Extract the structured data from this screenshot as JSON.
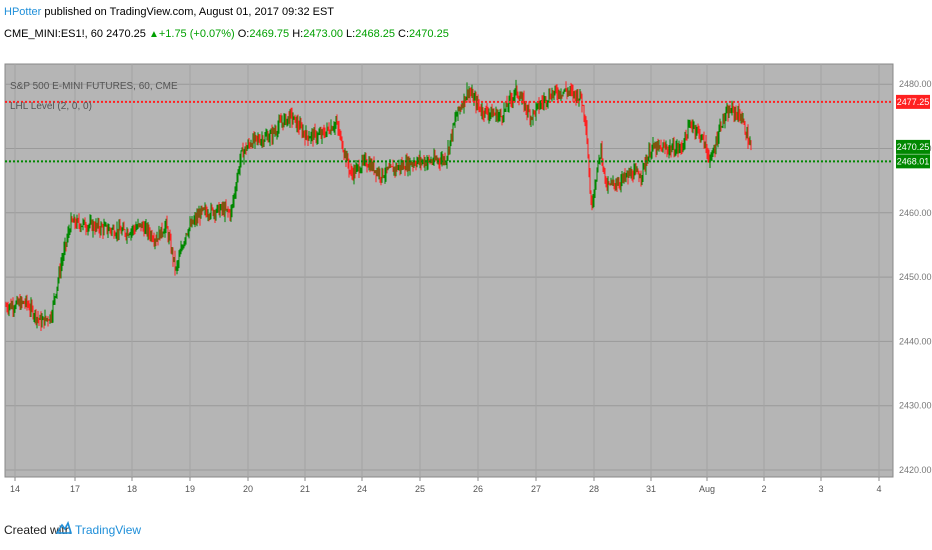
{
  "header": {
    "author": "HPotter",
    "published_text": "published on TradingView.com, August 01, 2017 09:32 EST",
    "symbol_line": "CME_MINI:ES1!, 60",
    "last_price": "2470.25",
    "change_arrow": "▲",
    "change": "+1.75 (+0.07%)",
    "o_label": "O:",
    "o_value": "2469.75",
    "h_label": "H:",
    "h_value": "2473.00",
    "l_label": "L:",
    "l_value": "2468.25",
    "c_label": "C:",
    "c_value": "2470.25"
  },
  "chart_data": {
    "type": "candlestick",
    "title": "S&P 500 E-MINI FUTURES, 60, CME",
    "indicator_label": "LHL Level (2, 0, 0)",
    "y_ticks": [
      2420,
      2430,
      2440,
      2450,
      2460,
      2470,
      2480
    ],
    "y_tick_labels": [
      "2420.00",
      "2430.00",
      "2440.00",
      "2450.00",
      "2460.00",
      "2470.00",
      "2480.00"
    ],
    "ylim": [
      2419.5,
      2483
    ],
    "x_tick_labels": [
      "14",
      "17",
      "18",
      "19",
      "20",
      "21",
      "24",
      "25",
      "26",
      "27",
      "28",
      "31",
      "Aug",
      "2",
      "3",
      "4"
    ],
    "anchors": [
      [
        0,
        2445.5
      ],
      [
        20,
        2446
      ],
      [
        35,
        2443
      ],
      [
        45,
        2444
      ],
      [
        55,
        2452
      ],
      [
        65,
        2458.5
      ],
      [
        85,
        2458
      ],
      [
        100,
        2457.5
      ],
      [
        120,
        2457
      ],
      [
        135,
        2458
      ],
      [
        150,
        2456
      ],
      [
        160,
        2458
      ],
      [
        170,
        2451
      ],
      [
        180,
        2457
      ],
      [
        195,
        2460
      ],
      [
        215,
        2460.5
      ],
      [
        225,
        2460
      ],
      [
        235,
        2469
      ],
      [
        245,
        2471
      ],
      [
        265,
        2472
      ],
      [
        275,
        2474
      ],
      [
        285,
        2475
      ],
      [
        300,
        2472
      ],
      [
        315,
        2472
      ],
      [
        330,
        2474
      ],
      [
        345,
        2466
      ],
      [
        360,
        2468
      ],
      [
        375,
        2466
      ],
      [
        390,
        2467
      ],
      [
        410,
        2468
      ],
      [
        425,
        2468
      ],
      [
        440,
        2468.5
      ],
      [
        450,
        2475
      ],
      [
        462,
        2479
      ],
      [
        475,
        2476
      ],
      [
        495,
        2475
      ],
      [
        510,
        2479
      ],
      [
        525,
        2475
      ],
      [
        535,
        2477
      ],
      [
        545,
        2478.5
      ],
      [
        560,
        2479
      ],
      [
        575,
        2478
      ],
      [
        580,
        2474
      ],
      [
        585,
        2461
      ],
      [
        595,
        2470
      ],
      [
        600,
        2464
      ],
      [
        615,
        2465
      ],
      [
        625,
        2466
      ],
      [
        635,
        2466
      ],
      [
        645,
        2470
      ],
      [
        660,
        2470
      ],
      [
        675,
        2470
      ],
      [
        685,
        2474
      ],
      [
        695,
        2472
      ],
      [
        705,
        2468
      ],
      [
        715,
        2474
      ],
      [
        725,
        2476
      ],
      [
        735,
        2475
      ],
      [
        745,
        2470
      ]
    ],
    "levels": [
      {
        "name": "resistance",
        "value": 2477.25,
        "label": "2477.25",
        "color": "#ff2020"
      },
      {
        "name": "support",
        "value": 2468.0,
        "label": "2468.01",
        "color": "#008800"
      }
    ],
    "last_price_badge": {
      "value": 2470.25,
      "label": "2470.25",
      "color": "#008800"
    },
    "background": "#b5b5b5",
    "grid": true,
    "up_color": "#008800",
    "down_color": "#ff2020"
  },
  "footer": {
    "created_with": "Created with",
    "brand": "TradingView",
    "logo_icon": "tradingview-logo-icon"
  }
}
